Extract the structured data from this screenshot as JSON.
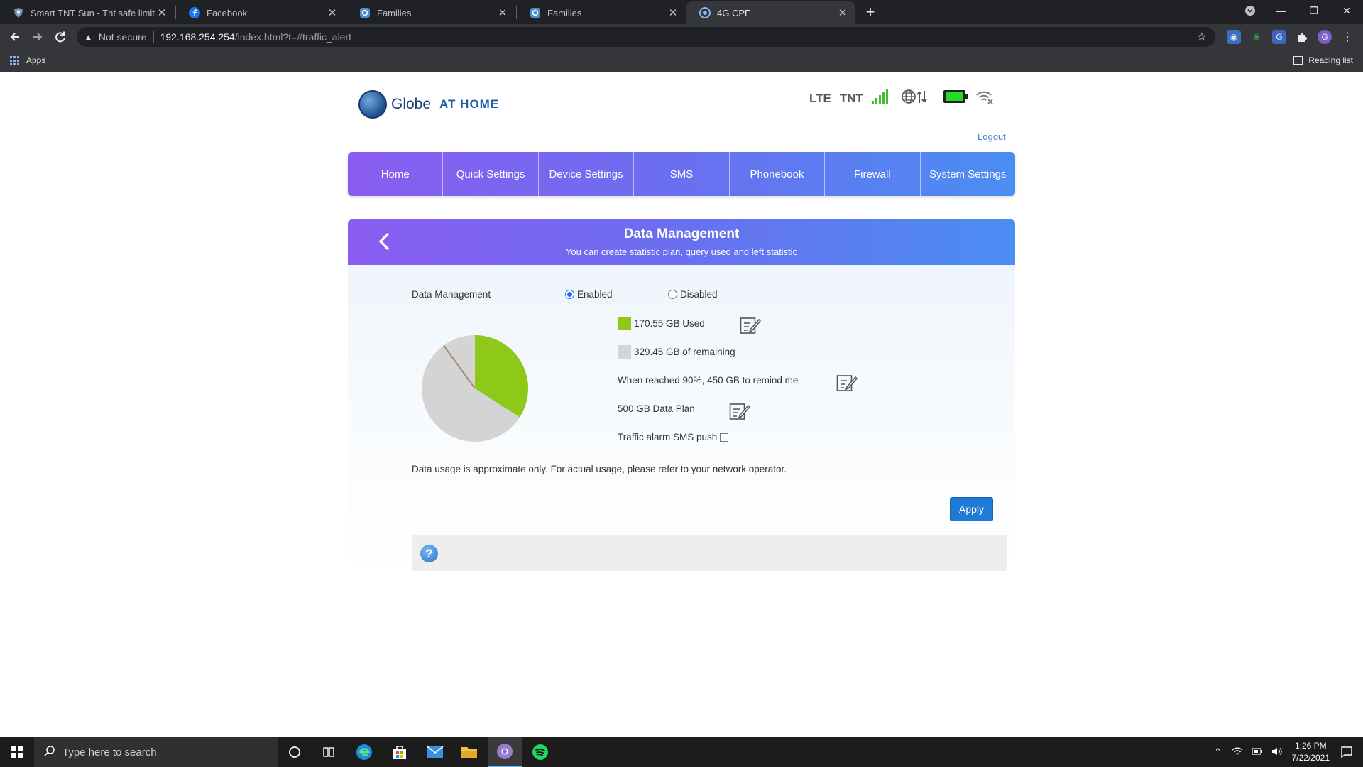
{
  "browser": {
    "tabs": [
      {
        "title": "Smart TNT Sun - Tnt safe limit | F",
        "icon": "shield-icon"
      },
      {
        "title": "Facebook",
        "icon": "facebook-icon"
      },
      {
        "title": "Families",
        "icon": "families-icon"
      },
      {
        "title": "Families",
        "icon": "families-icon"
      },
      {
        "title": "4G CPE",
        "icon": "chrome-icon",
        "active": true
      }
    ],
    "new_tab": "+",
    "address": {
      "security_label": "Not secure",
      "host": "192.168.254.254",
      "path": "/index.html?t=#traffic_alert"
    },
    "bookmarks": {
      "apps_label": "Apps",
      "reading_list_label": "Reading list"
    },
    "profile_initial": "G"
  },
  "header": {
    "brand": "Globe",
    "brand_suffix": "AT HOME",
    "network_type": "LTE",
    "operator": "TNT",
    "logout_label": "Logout"
  },
  "nav": {
    "items": [
      "Home",
      "Quick Settings",
      "Device Settings",
      "SMS",
      "Phonebook",
      "Firewall",
      "System Settings"
    ]
  },
  "section": {
    "title": "Data Management",
    "subtitle": "You can create statistic plan, query used and left statistic"
  },
  "form": {
    "data_management_label": "Data Management",
    "enabled_label": "Enabled",
    "disabled_label": "Disabled",
    "enabled_selected": true,
    "used_label": "170.55 GB Used",
    "remaining_label": "329.45 GB of remaining",
    "remind_label": "When reached 90%, 450 GB to remind me",
    "plan_label": "500 GB Data Plan",
    "sms_push_label": "Traffic alarm SMS push",
    "sms_push_checked": false,
    "note": "Data usage is approximate only. For actual usage, please refer to your network operator.",
    "apply_label": "Apply",
    "colors": {
      "used": "#8ec919",
      "remaining": "#d4d4d4",
      "threshold": "#a38b72"
    }
  },
  "chart_data": {
    "type": "pie",
    "title": "",
    "slices": [
      {
        "label": "170.55 GB Used",
        "value": 170.55,
        "color": "#8ec919"
      },
      {
        "label": "329.45 GB of remaining",
        "value": 329.45,
        "color": "#d4d4d4"
      }
    ],
    "threshold_percent": 90,
    "total_gb": 500
  },
  "taskbar": {
    "search_placeholder": "Type here to search",
    "time": "1:26 PM",
    "date": "7/22/2021"
  }
}
